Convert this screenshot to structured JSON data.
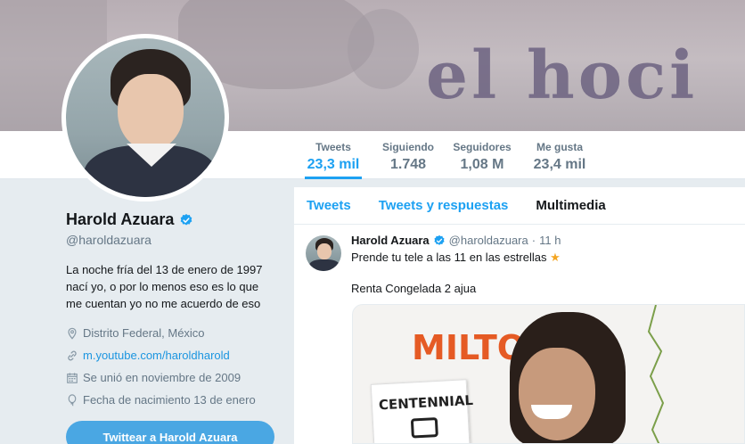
{
  "banner": {
    "text": "el hoci"
  },
  "stats": [
    {
      "label": "Tweets",
      "value": "23,3 mil",
      "active": true
    },
    {
      "label": "Siguiendo",
      "value": "1.748"
    },
    {
      "label": "Seguidores",
      "value": "1,08 M"
    },
    {
      "label": "Me gusta",
      "value": "23,4 mil"
    }
  ],
  "profile": {
    "name": "Harold Azuara",
    "handle": "@haroldazuara",
    "bio": "La noche fría del 13 de enero de 1997 nací yo, o por lo menos eso es lo que me cuentan yo no me acuerdo de eso",
    "location": "Distrito Federal, México",
    "website": "m.youtube.com/haroldharold",
    "joined": "Se unió en noviembre de 2009",
    "birthday": "Fecha de nacimiento 13 de enero",
    "tweet_button": "Twittear a Harold Azuara"
  },
  "tabs": [
    {
      "label": "Tweets"
    },
    {
      "label": "Tweets y respuestas"
    },
    {
      "label": "Multimedia",
      "active": true
    }
  ],
  "tweet": {
    "name": "Harold Azuara",
    "handle": "@haroldazuara",
    "dot": "·",
    "time": "11 h",
    "text": "Prende tu tele a las 11 en las estrellas",
    "text2": "Renta Congelada 2 ajua",
    "media": {
      "title": "MILTON",
      "card": "CENTENNIAL"
    }
  },
  "colors": {
    "accent": "#1da1f2",
    "verified": "#1da1f2",
    "button": "#4aa7e3"
  }
}
